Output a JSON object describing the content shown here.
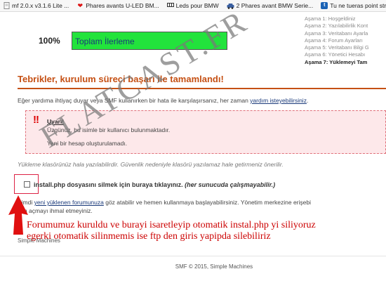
{
  "bookmarks": [
    {
      "label": "mf 2.0.x v3.1.6 Lite ...",
      "icon": "doc-icon"
    },
    {
      "label": "Phares avants U-LED BM...",
      "icon": "heart-icon"
    },
    {
      "label": "Leds pour BMW",
      "icon": "leds-icon"
    },
    {
      "label": "2 Phares avant BMW Serie...",
      "icon": "car-icon"
    },
    {
      "label": "Tu ne tueras point stream",
      "icon": "tu-icon"
    }
  ],
  "progress": {
    "percent_label": "100%",
    "bar_label": "Toplam İlerleme",
    "value": 1.0,
    "fill_color": "#22e33c"
  },
  "steps": [
    "Aşama 1: Hoşgeldiniz",
    "Aşama 2: Yazılabilirlik Kont",
    "Aşama 3: Veritabanı Ayarla",
    "Aşama 4: Forum Ayarları",
    "Aşama 5: Veritabanı Bilgi G",
    "Aşama 6: Yönetici Hesabı",
    "Aşama 7: Yüklemeyi Tam"
  ],
  "heading": "Tebrikler, kurulum süreci başarı ile tamamlandı!",
  "intro": {
    "text": "Eğer yardıma ihtiyaç duyar veya SMF kullanırken bir hata ile karşılaşırsanız, her zaman ",
    "link": "yardım isteyebilirsiniz",
    "end": "."
  },
  "warning": {
    "mark": "!!",
    "title": "Uyarı!",
    "line1": "Üzgünüz, bu isimle bir kullanıcı bulunmaktadır.",
    "line2": "Yeni bir hesap oluşturulamadı."
  },
  "note": "Yükleme klasörünüz hala yazılabilirdir. Güvenlik nedeniyle klasörü yazılamaz hale getirmeniz önerilir.",
  "checkbox": {
    "label": "install.php dosyasını silmek için buraya tıklayınız.",
    "note": "(her sunucuda çalışmayabilir.)",
    "checked": false
  },
  "now": {
    "prefix": "Şimdi ",
    "link": "yeni yüklenen forumunuza",
    "rest": " göz atabilir ve hemen kullanmaya başlayabilirsiniz. Yönetim merkezine erişebi",
    "line2": "lem açmayı ihmal etmeyiniz."
  },
  "hidden": {
    "line1": "İy",
    "line2": "Simple Machines"
  },
  "annotation": {
    "line1": "Forumumuz kuruldu ve burayi isaretleyip otomatik instal.php yi siliyoruz",
    "line2": "egerki otomatik silinmemis ise ftp den giris yapipda silebiliriz",
    "color": "#cc0000"
  },
  "watermark": "FLATCAST.FR",
  "footer": "SMF © 2015, Simple Machines",
  "colors": {
    "accent": "#c55014",
    "link": "#1a3a7a",
    "warning_bg": "#fde8ea"
  }
}
